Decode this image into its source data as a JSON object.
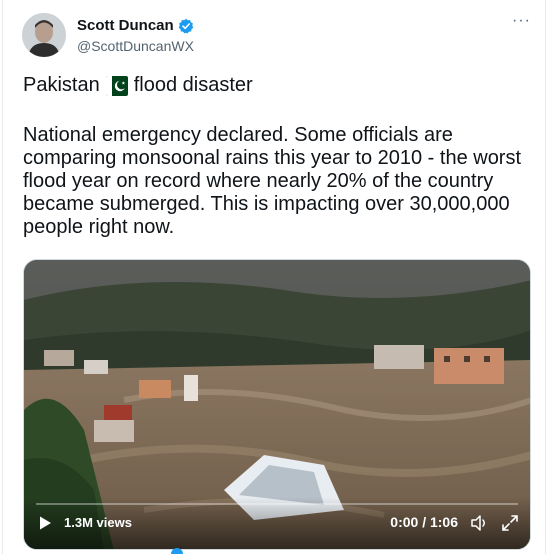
{
  "author": {
    "name": "Scott Duncan",
    "handle": "@ScottDuncanWX",
    "verified_icon": "verified-badge-icon",
    "more_icon": "more-options-icon",
    "more_glyph": "···"
  },
  "tweet": {
    "title_before_flag": "Pakistan",
    "flag_icon": "pakistan-flag-icon",
    "title_after_flag": "flood disaster",
    "body": "National emergency declared. Some officials are comparing monsoonal rains this year to 2010 - the worst flood year on record where nearly 20% of the country became submerged. This is impacting over 30,000,000 people right now."
  },
  "video": {
    "views": "1.3M views",
    "time": "0:00 / 1:06",
    "progress": 0,
    "play_icon": "play-icon",
    "volume_icon": "volume-icon",
    "expand_icon": "fullscreen-icon"
  },
  "colors": {
    "accent": "#1d9bf0",
    "text": "#0f1419",
    "muted": "#536471",
    "flag_green": "#01411c"
  }
}
